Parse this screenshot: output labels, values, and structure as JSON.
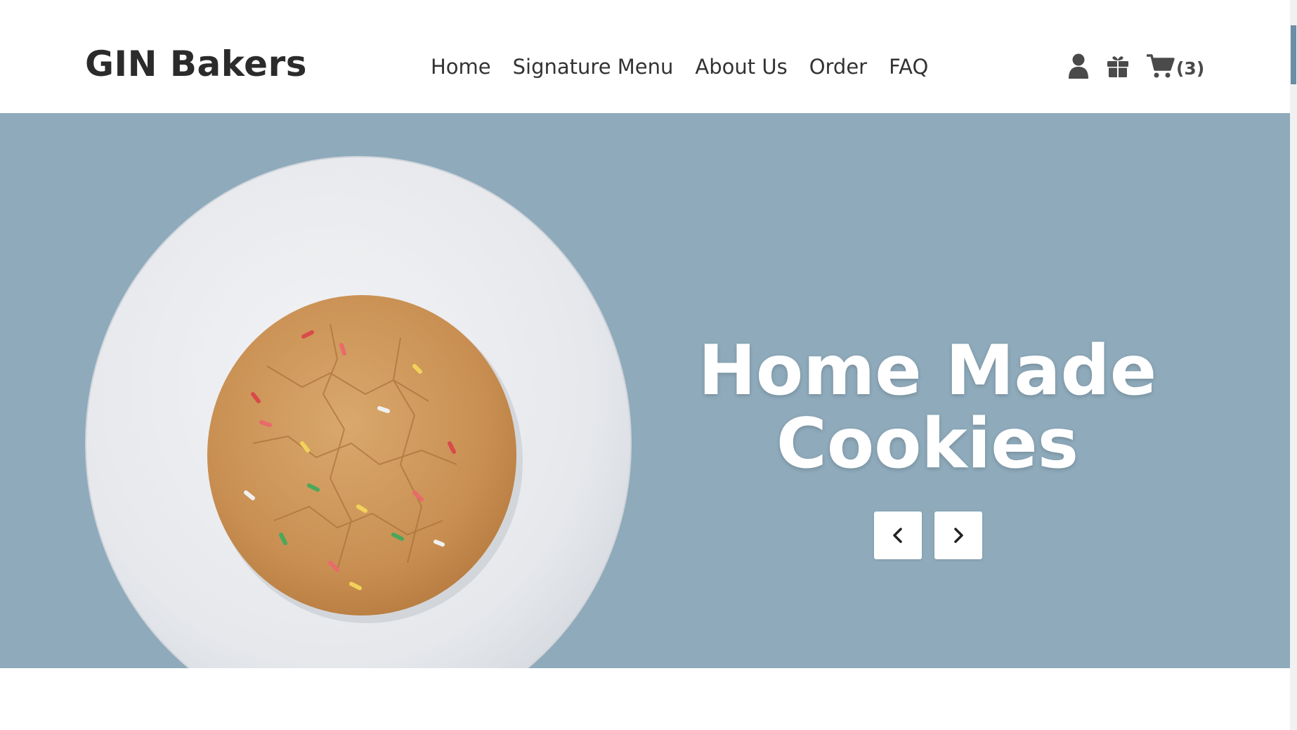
{
  "header": {
    "brand": "GIN Bakers",
    "nav": [
      {
        "label": "Home"
      },
      {
        "label": "Signature Menu"
      },
      {
        "label": "About Us"
      },
      {
        "label": "Order"
      },
      {
        "label": "FAQ"
      }
    ],
    "icons": {
      "account": "user-icon",
      "gift": "gift-box-icon",
      "cart": "shopping-cart-icon"
    },
    "cart_count": "(3)"
  },
  "hero": {
    "title_line1": "Home Made",
    "title_line2": "Cookies",
    "prev_icon": "chevron-left-icon",
    "next_icon": "chevron-right-icon",
    "image": "cookie-on-plate"
  },
  "colors": {
    "hero_bg": "#8eaabb",
    "text_dark": "#2b2b2b",
    "scroll_thumb": "#6a8ea6"
  }
}
